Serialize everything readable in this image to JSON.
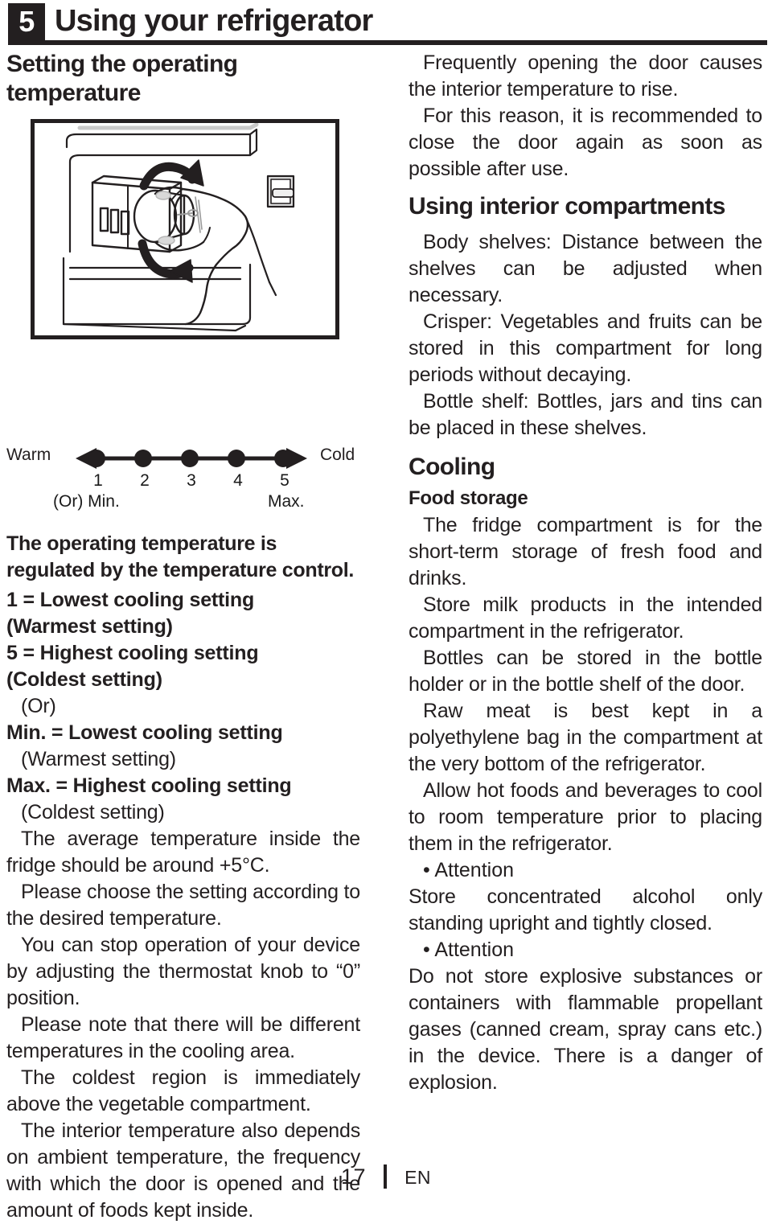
{
  "header": {
    "chapter_number": "5",
    "title": "Using your refrigerator"
  },
  "left_column": {
    "section_heading": "Setting the operating temperature",
    "illustration_caption": "thermostat-knob-adjustment-line-drawing",
    "lead_bold": "The operating temperature is regulated by the temperature control.",
    "scale": {
      "left_label": "Warm",
      "right_label": "Cold",
      "ticks": [
        "1",
        "2",
        "3",
        "4",
        "5"
      ],
      "min_label": "(Or) Min.",
      "max_label": "Max."
    },
    "definitions": [
      {
        "style": "bold",
        "text": "1 = Lowest cooling setting"
      },
      {
        "style": "bold",
        "text": "(Warmest setting)"
      },
      {
        "style": "bold",
        "text": "5 = Highest cooling setting"
      },
      {
        "style": "bold",
        "text": "(Coldest setting)"
      },
      {
        "style": "plain",
        "text": "(Or)"
      },
      {
        "style": "bold",
        "text": "Min. = Lowest cooling setting"
      },
      {
        "style": "plain",
        "text": "(Warmest setting)"
      },
      {
        "style": "bold",
        "text": "Max. = Highest cooling setting"
      },
      {
        "style": "plain",
        "text": "(Coldest setting)"
      }
    ],
    "paragraphs": [
      "The average temperature inside the fridge should be around +5°C.",
      "Please choose the setting according to the desired temperature.",
      "You can stop operation of your device by adjusting the thermostat knob to “0” position.",
      "Please note that there will be different temperatures in the cooling area.",
      "The coldest region is immediately above the vegetable compartment.",
      "The interior temperature also depends on ambient temperature, the frequency with which the door is opened and the amount of foods kept inside."
    ]
  },
  "right_column": {
    "intro_paragraphs": [
      "Frequently opening the door causes the interior temperature to rise.",
      "For this reason, it is recommended to close the door again as soon as possible after use."
    ],
    "compartments_heading": "Using interior compartments",
    "compartments_paragraphs": [
      "Body shelves: Distance between the shelves can be adjusted when necessary.",
      "Crisper: Vegetables and fruits can be stored in this compartment for long periods without decaying.",
      "Bottle shelf: Bottles, jars and tins can be placed in these shelves."
    ],
    "cooling_heading": "Cooling",
    "food_storage_heading": "Food storage",
    "food_storage_paragraphs": [
      "The fridge compartment is for the short-term storage of fresh food and drinks.",
      "Store milk products in the intended compartment in the refrigerator.",
      "Bottles can be stored in the bottle holder or in the bottle shelf of the door.",
      "Raw meat is best kept in a polyethylene bag in the compartment at the very bottom of the refrigerator.",
      "Allow hot foods and beverages to cool to room temperature prior to placing them in the refrigerator."
    ],
    "attention_blocks": [
      {
        "bullet": "• Attention",
        "text": "Store concentrated alcohol only standing upright and tightly closed."
      },
      {
        "bullet": "• Attention",
        "text": "Do not store explosive substances or containers with flammable propellant gases (canned cream, spray cans etc.) in the device. There is a danger of explosion."
      }
    ]
  },
  "footer": {
    "page_number": "17",
    "language": "EN"
  },
  "colors": {
    "ink": "#231f20",
    "page": "#ffffff"
  }
}
